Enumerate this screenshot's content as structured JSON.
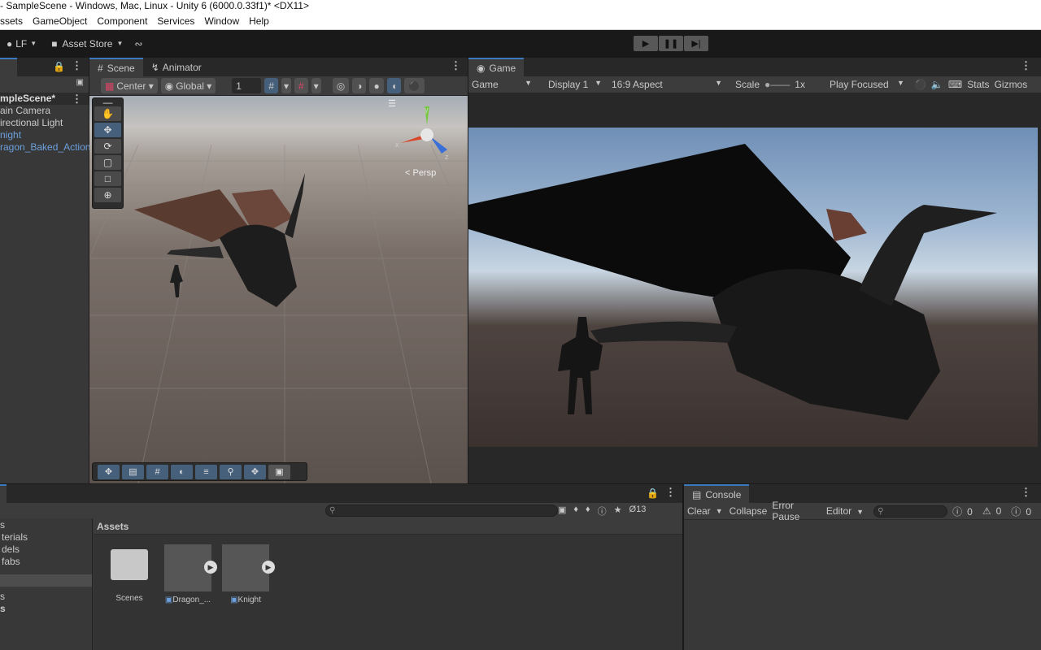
{
  "window_title": "- SampleScene - Windows, Mac, Linux - Unity 6 (6000.0.33f1)* <DX11>",
  "menu": [
    "ssets",
    "GameObject",
    "Component",
    "Services",
    "Window",
    "Help"
  ],
  "toolbar": {
    "account": "LF",
    "asset_store": "Asset Store"
  },
  "scene_tabs": {
    "scene": "Scene",
    "animator": "Animator"
  },
  "scene_toolbar": {
    "pivot": "Center",
    "space": "Global",
    "grid_value": "1"
  },
  "scene_view": {
    "persp_label": "< Persp",
    "gizmo_axes": {
      "y": "y",
      "x": "x",
      "z": "z"
    }
  },
  "hierarchy": {
    "scene_name": "mpleScene*",
    "items": [
      "ain Camera",
      "irectional Light",
      "night",
      "ragon_Baked_Action"
    ]
  },
  "game": {
    "tab": "Game",
    "display_mode": "Game",
    "display": "Display 1",
    "aspect": "16:9 Aspect",
    "scale_label": "Scale",
    "scale_value": "1x",
    "play_mode": "Play Focused",
    "stats": "Stats",
    "gizmos": "Gizmos"
  },
  "project": {
    "tree": [
      "s",
      "terials",
      "dels",
      "fabs",
      "",
      "s",
      "s"
    ],
    "breadcrumb": "Assets",
    "hidden_count": "13",
    "assets": [
      {
        "name": "Scenes",
        "type": "folder"
      },
      {
        "name": "Dragon_...",
        "type": "prefab"
      },
      {
        "name": "Knight",
        "type": "prefab"
      }
    ]
  },
  "console": {
    "tab": "Console",
    "clear": "Clear",
    "collapse": "Collapse",
    "error_pause": "Error Pause",
    "editor": "Editor",
    "log_count": "0",
    "warn_count": "0",
    "error_count": "0"
  },
  "colors": {
    "accent": "#3a79bb",
    "selected_text": "#6ca0dc",
    "panel": "#383838"
  }
}
